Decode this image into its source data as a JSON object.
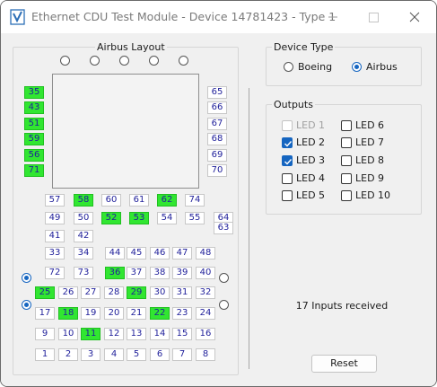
{
  "window": {
    "title": "Ethernet CDU Test Module - Device 14781423 - Type 1"
  },
  "layout_group": {
    "title": "Airbus Layout",
    "left_keys": [
      {
        "label": "35",
        "on": true
      },
      {
        "label": "43",
        "on": true
      },
      {
        "label": "51",
        "on": true
      },
      {
        "label": "59",
        "on": true
      },
      {
        "label": "56",
        "on": true
      },
      {
        "label": "71",
        "on": true
      }
    ],
    "right_keys": [
      {
        "label": "65",
        "on": false
      },
      {
        "label": "66",
        "on": false
      },
      {
        "label": "67",
        "on": false
      },
      {
        "label": "68",
        "on": false
      },
      {
        "label": "69",
        "on": false
      },
      {
        "label": "70",
        "on": false
      }
    ],
    "grid_rows": [
      [
        {
          "label": "57",
          "on": false
        },
        {
          "label": "58",
          "on": true
        },
        {
          "label": "60",
          "on": false
        },
        {
          "label": "61",
          "on": false
        },
        {
          "label": "62",
          "on": true
        },
        {
          "label": "74",
          "on": false
        }
      ],
      [
        {
          "label": "49",
          "on": false
        },
        {
          "label": "50",
          "on": false
        },
        {
          "label": "52",
          "on": true
        },
        {
          "label": "53",
          "on": true
        },
        {
          "label": "54",
          "on": false
        },
        {
          "label": "55",
          "on": false
        },
        {
          "label": "64",
          "on": false
        }
      ],
      [
        {
          "label": "63",
          "on": false
        }
      ],
      [
        {
          "label": "41",
          "on": false
        },
        {
          "label": "42",
          "on": false
        }
      ],
      [
        {
          "label": "33",
          "on": false
        },
        {
          "label": "34",
          "on": false
        },
        {
          "label": "44",
          "on": false
        },
        {
          "label": "45",
          "on": false
        },
        {
          "label": "46",
          "on": false
        },
        {
          "label": "47",
          "on": false
        },
        {
          "label": "48",
          "on": false
        }
      ],
      [
        {
          "label": "72",
          "on": false
        },
        {
          "label": "73",
          "on": false
        },
        {
          "label": "36",
          "on": true
        },
        {
          "label": "37",
          "on": false
        },
        {
          "label": "38",
          "on": false
        },
        {
          "label": "39",
          "on": false
        },
        {
          "label": "40",
          "on": false
        }
      ],
      [
        {
          "label": "25",
          "on": true
        },
        {
          "label": "26",
          "on": false
        },
        {
          "label": "27",
          "on": false
        },
        {
          "label": "28",
          "on": false
        },
        {
          "label": "29",
          "on": true
        },
        {
          "label": "30",
          "on": false
        },
        {
          "label": "31",
          "on": false
        },
        {
          "label": "32",
          "on": false
        }
      ],
      [
        {
          "label": "17",
          "on": false
        },
        {
          "label": "18",
          "on": true
        },
        {
          "label": "19",
          "on": false
        },
        {
          "label": "20",
          "on": false
        },
        {
          "label": "21",
          "on": false
        },
        {
          "label": "22",
          "on": true
        },
        {
          "label": "23",
          "on": false
        },
        {
          "label": "24",
          "on": false
        }
      ],
      [
        {
          "label": "9",
          "on": false
        },
        {
          "label": "10",
          "on": false
        },
        {
          "label": "11",
          "on": true
        },
        {
          "label": "12",
          "on": false
        },
        {
          "label": "13",
          "on": false
        },
        {
          "label": "14",
          "on": false
        },
        {
          "label": "15",
          "on": false
        },
        {
          "label": "16",
          "on": false
        }
      ],
      [
        {
          "label": "1",
          "on": false
        },
        {
          "label": "2",
          "on": false
        },
        {
          "label": "3",
          "on": false
        },
        {
          "label": "4",
          "on": false
        },
        {
          "label": "5",
          "on": false
        },
        {
          "label": "6",
          "on": false
        },
        {
          "label": "7",
          "on": false
        },
        {
          "label": "8",
          "on": false
        }
      ]
    ]
  },
  "device_type": {
    "title": "Device Type",
    "boeing_label": "Boeing",
    "airbus_label": "Airbus",
    "selected": "Airbus"
  },
  "outputs": {
    "title": "Outputs",
    "leds": [
      {
        "label": "LED 1",
        "checked": false,
        "enabled": false
      },
      {
        "label": "LED 2",
        "checked": true,
        "enabled": true
      },
      {
        "label": "LED 3",
        "checked": true,
        "enabled": true
      },
      {
        "label": "LED 4",
        "checked": false,
        "enabled": true
      },
      {
        "label": "LED 5",
        "checked": false,
        "enabled": true
      },
      {
        "label": "LED 6",
        "checked": false,
        "enabled": true
      },
      {
        "label": "LED 7",
        "checked": false,
        "enabled": true
      },
      {
        "label": "LED 8",
        "checked": false,
        "enabled": true
      },
      {
        "label": "LED 9",
        "checked": false,
        "enabled": true
      },
      {
        "label": "LED 10",
        "checked": false,
        "enabled": true
      }
    ]
  },
  "status": {
    "text": "17 Inputs received"
  },
  "reset_button": {
    "label": "Reset"
  },
  "colors": {
    "key_on": "#31e631",
    "key_text": "#1f1f9a",
    "accent": "#1565c0"
  }
}
